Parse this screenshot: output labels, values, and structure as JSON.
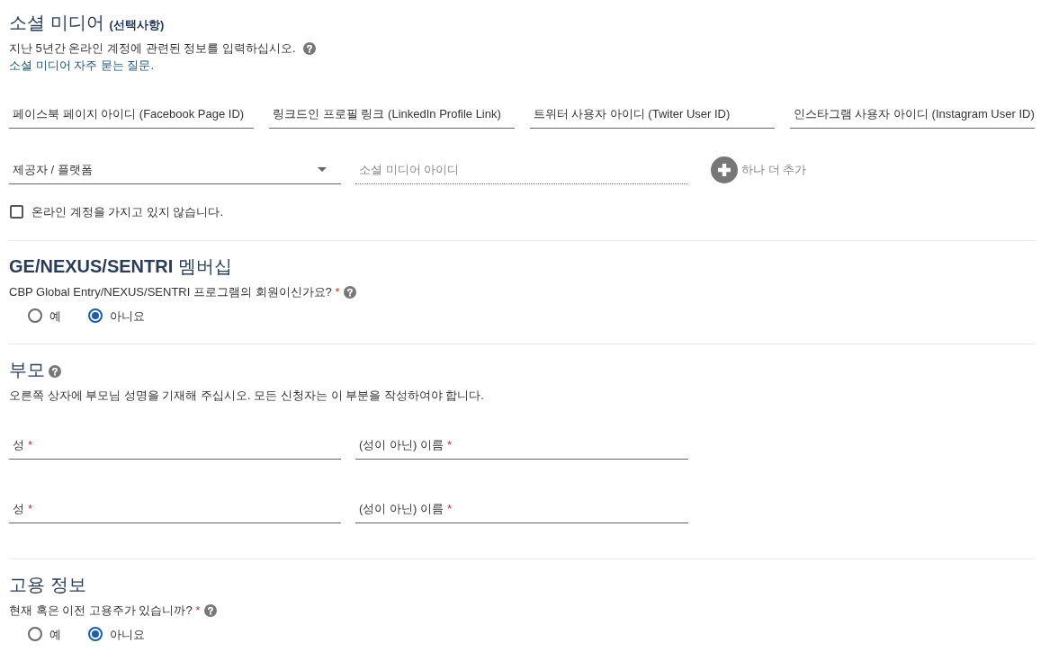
{
  "sections": [
    {
      "kind": "social_media",
      "title": "소셜 미디어",
      "title_note": "(선택사항)",
      "title_help": false,
      "description": "지난 5년간 온라인 계정에 관련된 정보를 입력하십시오.",
      "description_help": true,
      "faq_link": "소셜 미디어 자주 묻는 질문.",
      "account_fields": [
        {
          "placeholder": "페이스북 페이지 아이디 (Facebook Page ID)"
        },
        {
          "placeholder": "링크드인 프로필 링크 (LinkedIn Profile Link)"
        },
        {
          "placeholder": "트위터 사용자 아이디 (Twiter User ID)"
        },
        {
          "placeholder": "인스타그램 사용자 아이디 (Instagram User ID)"
        }
      ],
      "entry_fields": [
        {
          "kind": "select",
          "placeholder": "제공자 / 플랫폼",
          "disabled": false
        },
        {
          "kind": "text",
          "placeholder": "소셜 미디어 아이디",
          "disabled": true
        }
      ],
      "add_button": "하나 더 추가",
      "no_account_checkbox": {
        "label": "온라인 계정을 가지고 있지 않습니다.",
        "checked": false
      }
    },
    {
      "kind": "question",
      "title": "**GE/NEXUS/SENTRI** 멤버십",
      "title_help": false,
      "question": {
        "text": "CBP Global Entry/NEXUS/SENTRI 프로그램의 회원이신가요?",
        "required_mark": "*",
        "help": true
      },
      "options": [
        {
          "label": "예",
          "selected": false
        },
        {
          "label": "아니요",
          "selected": true
        }
      ]
    },
    {
      "kind": "names",
      "title": "부모",
      "title_help": true,
      "description": "오른쪽 상자에 부모님 성명을 기재해 주십시오. 모든 신청자는 이 부분을 작성하여야 합니다.",
      "description_help": false,
      "name_rows": [
        {
          "fields": [
            {
              "placeholder": "성",
              "required_mark": "*"
            },
            {
              "placeholder": "(성이 아닌) 이름",
              "required_mark": "*"
            }
          ]
        },
        {
          "fields": [
            {
              "placeholder": "성",
              "required_mark": "*"
            },
            {
              "placeholder": "(성이 아닌) 이름",
              "required_mark": "*"
            }
          ]
        }
      ]
    },
    {
      "kind": "question",
      "title": "고용 정보",
      "title_help": false,
      "question": {
        "text": "현재 혹은 이전 고용주가 있습니까?",
        "required_mark": "*",
        "help": true
      },
      "options": [
        {
          "label": "예",
          "selected": false
        },
        {
          "label": "아니요",
          "selected": true
        }
      ]
    }
  ]
}
